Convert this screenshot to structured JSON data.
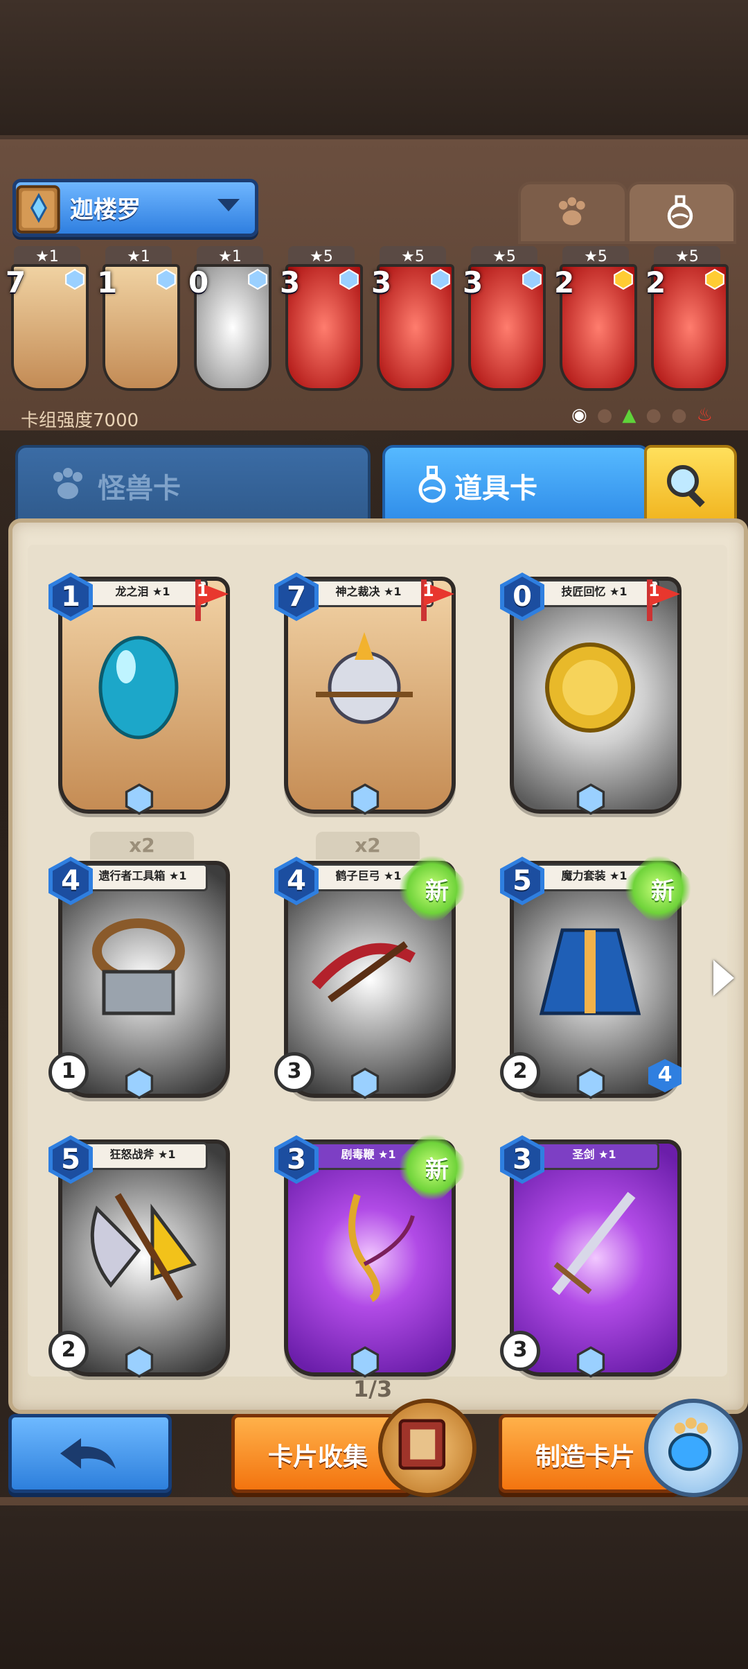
{
  "deck": {
    "name": "迦楼罗",
    "power_label": "卡组强度7000",
    "cards": [
      {
        "stars": "★1",
        "cost": "7",
        "color": "gold"
      },
      {
        "stars": "★1",
        "cost": "1",
        "color": "gold"
      },
      {
        "stars": "★1",
        "cost": "0",
        "color": "gray"
      },
      {
        "stars": "★5",
        "cost": "3",
        "color": "red"
      },
      {
        "stars": "★5",
        "cost": "3",
        "color": "red"
      },
      {
        "stars": "★5",
        "cost": "3",
        "color": "red"
      },
      {
        "stars": "★5",
        "cost": "2",
        "color": "red"
      },
      {
        "stars": "★5",
        "cost": "2",
        "color": "red"
      }
    ]
  },
  "tabs": {
    "monster_label": "怪兽卡",
    "item_label": "道具卡"
  },
  "cards": [
    {
      "name": "龙之泪 ★1",
      "cost": "1",
      "flag": "1",
      "badge": "",
      "dup": "",
      "rarity": "gold"
    },
    {
      "name": "神之裁决 ★1",
      "cost": "7",
      "flag": "1",
      "badge": "",
      "dup": "",
      "rarity": "gold"
    },
    {
      "name": "技匠回忆 ★1",
      "cost": "0",
      "flag": "1",
      "badge": "",
      "dup": "",
      "rarity": "gray"
    },
    {
      "name": "遗行者工具箱 ★1",
      "cost": "4",
      "flag": "",
      "badge": "",
      "dup": "x2",
      "rarity": "gray",
      "left": "1"
    },
    {
      "name": "鹤子巨弓 ★1",
      "cost": "4",
      "flag": "",
      "badge": "新",
      "dup": "x2",
      "rarity": "gray",
      "left": "3"
    },
    {
      "name": "魔力套装 ★1",
      "cost": "5",
      "flag": "",
      "badge": "新",
      "dup": "",
      "rarity": "gray",
      "left": "2",
      "right": "4"
    },
    {
      "name": "狂怒战斧 ★1",
      "cost": "5",
      "flag": "",
      "badge": "",
      "dup": "",
      "rarity": "gray",
      "left": "2"
    },
    {
      "name": "剧毒鞭 ★1",
      "cost": "3",
      "flag": "",
      "badge": "新",
      "dup": "",
      "rarity": "purple"
    },
    {
      "name": "圣剑 ★1",
      "cost": "3",
      "flag": "",
      "badge": "",
      "dup": "",
      "rarity": "purple",
      "left": "3"
    }
  ],
  "pager": "1/3",
  "buttons": {
    "collect": "卡片收集",
    "craft": "制造卡片"
  }
}
